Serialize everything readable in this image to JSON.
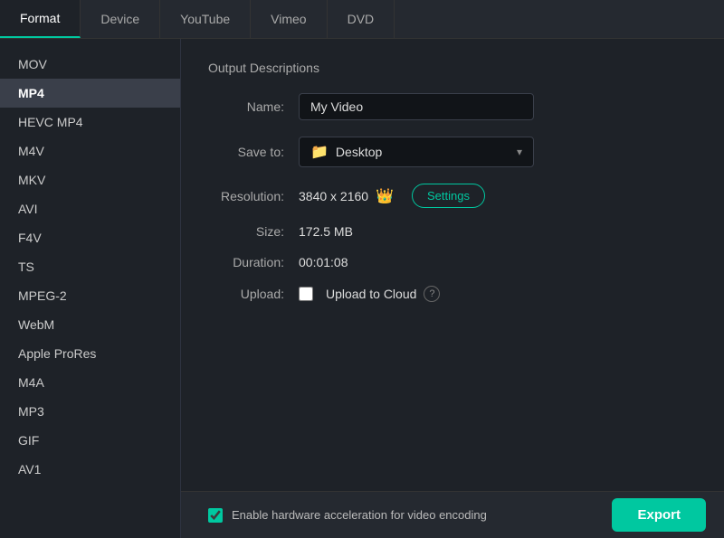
{
  "tabs": [
    {
      "id": "format",
      "label": "Format",
      "active": true
    },
    {
      "id": "device",
      "label": "Device",
      "active": false
    },
    {
      "id": "youtube",
      "label": "YouTube",
      "active": false
    },
    {
      "id": "vimeo",
      "label": "Vimeo",
      "active": false
    },
    {
      "id": "dvd",
      "label": "DVD",
      "active": false
    }
  ],
  "sidebar": {
    "items": [
      {
        "id": "mov",
        "label": "MOV",
        "active": false
      },
      {
        "id": "mp4",
        "label": "MP4",
        "active": true
      },
      {
        "id": "hevc-mp4",
        "label": "HEVC MP4",
        "active": false
      },
      {
        "id": "m4v",
        "label": "M4V",
        "active": false
      },
      {
        "id": "mkv",
        "label": "MKV",
        "active": false
      },
      {
        "id": "avi",
        "label": "AVI",
        "active": false
      },
      {
        "id": "f4v",
        "label": "F4V",
        "active": false
      },
      {
        "id": "ts",
        "label": "TS",
        "active": false
      },
      {
        "id": "mpeg2",
        "label": "MPEG-2",
        "active": false
      },
      {
        "id": "webm",
        "label": "WebM",
        "active": false
      },
      {
        "id": "apple-prores",
        "label": "Apple ProRes",
        "active": false
      },
      {
        "id": "m4a",
        "label": "M4A",
        "active": false
      },
      {
        "id": "mp3",
        "label": "MP3",
        "active": false
      },
      {
        "id": "gif",
        "label": "GIF",
        "active": false
      },
      {
        "id": "av1",
        "label": "AV1",
        "active": false
      }
    ]
  },
  "output": {
    "section_title": "Output Descriptions",
    "name_label": "Name:",
    "name_value": "My Video",
    "save_to_label": "Save to:",
    "save_to_value": "Desktop",
    "resolution_label": "Resolution:",
    "resolution_value": "3840 x 2160",
    "settings_label": "Settings",
    "size_label": "Size:",
    "size_value": "172.5 MB",
    "duration_label": "Duration:",
    "duration_value": "00:01:08",
    "upload_label": "Upload:",
    "upload_to_cloud_label": "Upload to Cloud"
  },
  "bottom": {
    "hw_label": "Enable hardware acceleration for video encoding",
    "export_label": "Export"
  }
}
